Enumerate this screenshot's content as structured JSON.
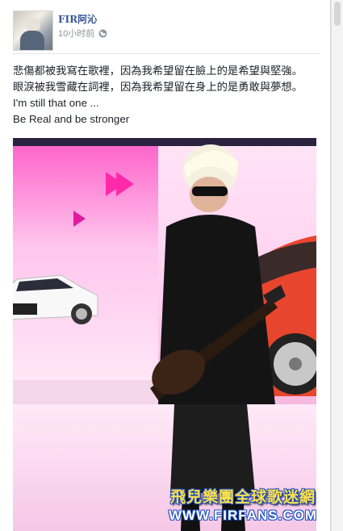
{
  "post": {
    "author": "FIR阿沁",
    "timestamp": "10小时前",
    "privacy_icon": "globe-icon",
    "lines": [
      "悲傷都被我寫在歌裡，因為我希望留在臉上的是希望與堅強。",
      "眼淚被我雪藏在詞裡，因為我希望留在身上的是勇敢與夢想。",
      "I'm still that one ...",
      "Be Real and be stronger"
    ]
  },
  "watermark": {
    "title": "飛兒樂團全球歌迷網",
    "url": "WWW.FIRFANS.COM"
  },
  "colors": {
    "link": "#3b5998",
    "meta": "#90949c",
    "text": "#1d2129",
    "watermark_yellow": "#ffe14a",
    "watermark_blue": "#1c4fbf"
  }
}
